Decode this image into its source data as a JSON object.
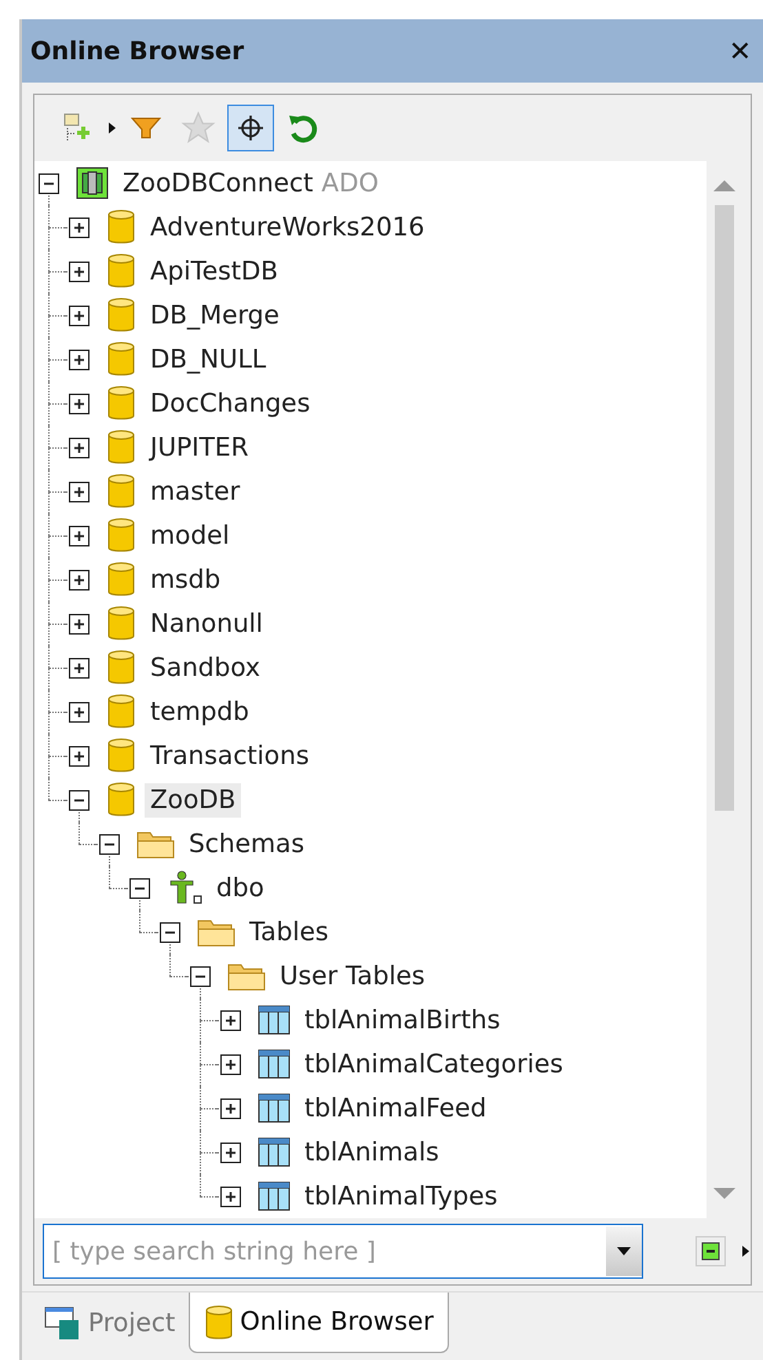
{
  "panel": {
    "title": "Online Browser",
    "close": "✕"
  },
  "toolbar": [
    {
      "kind": "add",
      "disabled": false,
      "pressed": false
    },
    {
      "kind": "filter",
      "disabled": false,
      "pressed": false
    },
    {
      "kind": "favorite",
      "disabled": true,
      "pressed": false
    },
    {
      "kind": "locate",
      "disabled": false,
      "pressed": true
    },
    {
      "kind": "refresh",
      "disabled": false,
      "pressed": false
    }
  ],
  "tree": [
    {
      "label": "ZooDBConnect",
      "provider": "ADO",
      "kind": "connection",
      "expanded": true,
      "selected": false,
      "children": [
        {
          "label": "AdventureWorks2016",
          "kind": "database",
          "expanded": false,
          "selected": false
        },
        {
          "label": "ApiTestDB",
          "kind": "database",
          "expanded": false,
          "selected": false
        },
        {
          "label": "DB_Merge",
          "kind": "database",
          "expanded": false,
          "selected": false
        },
        {
          "label": "DB_NULL",
          "kind": "database",
          "expanded": false,
          "selected": false
        },
        {
          "label": "DocChanges",
          "kind": "database",
          "expanded": false,
          "selected": false
        },
        {
          "label": "JUPITER",
          "kind": "database",
          "expanded": false,
          "selected": false
        },
        {
          "label": "master",
          "kind": "database",
          "expanded": false,
          "selected": false
        },
        {
          "label": "model",
          "kind": "database",
          "expanded": false,
          "selected": false
        },
        {
          "label": "msdb",
          "kind": "database",
          "expanded": false,
          "selected": false
        },
        {
          "label": "Nanonull",
          "kind": "database",
          "expanded": false,
          "selected": false
        },
        {
          "label": "Sandbox",
          "kind": "database",
          "expanded": false,
          "selected": false
        },
        {
          "label": "tempdb",
          "kind": "database",
          "expanded": false,
          "selected": false
        },
        {
          "label": "Transactions",
          "kind": "database",
          "expanded": false,
          "selected": false
        },
        {
          "label": "ZooDB",
          "kind": "database",
          "expanded": true,
          "selected": true,
          "children": [
            {
              "label": "Schemas",
              "kind": "folder",
              "expanded": true,
              "selected": false,
              "children": [
                {
                  "label": "dbo",
                  "kind": "schema",
                  "expanded": true,
                  "selected": false,
                  "children": [
                    {
                      "label": "Tables",
                      "kind": "folder",
                      "expanded": true,
                      "selected": false,
                      "children": [
                        {
                          "label": "User Tables",
                          "kind": "folder",
                          "expanded": true,
                          "selected": false,
                          "children": [
                            {
                              "label": "tblAnimalBirths",
                              "kind": "table",
                              "expanded": false,
                              "selected": false
                            },
                            {
                              "label": "tblAnimalCategories",
                              "kind": "table",
                              "expanded": false,
                              "selected": false
                            },
                            {
                              "label": "tblAnimalFeed",
                              "kind": "table",
                              "expanded": false,
                              "selected": false
                            },
                            {
                              "label": "tblAnimals",
                              "kind": "table",
                              "expanded": false,
                              "selected": false
                            },
                            {
                              "label": "tblAnimalTypes",
                              "kind": "table",
                              "expanded": false,
                              "selected": false
                            }
                          ]
                        }
                      ]
                    }
                  ]
                }
              ]
            }
          ]
        }
      ]
    }
  ],
  "search": {
    "placeholder": "[ type search string here ]"
  },
  "tabs": [
    {
      "label": "Project",
      "kind": "project",
      "selected": false
    },
    {
      "label": "Online Browser",
      "kind": "database",
      "selected": true
    }
  ]
}
